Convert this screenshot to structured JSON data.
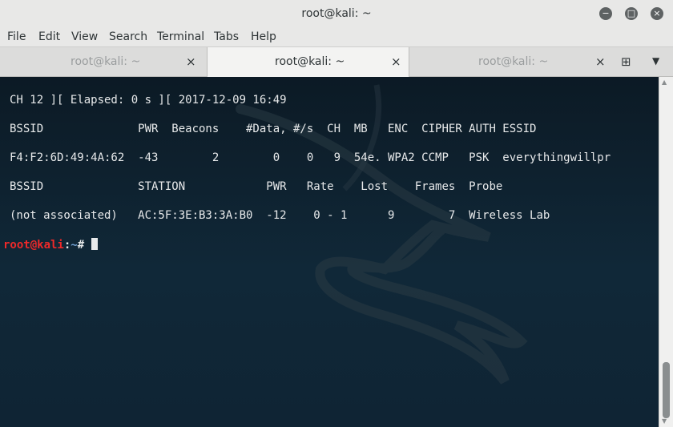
{
  "window": {
    "title": "root@kali: ~",
    "minimize_icon": "−",
    "maximize_icon": "□",
    "close_icon": "×"
  },
  "menu": [
    "File",
    "Edit",
    "View",
    "Search",
    "Terminal",
    "Tabs",
    "Help"
  ],
  "tabs": [
    {
      "label": "root@kali: ~",
      "close": "×",
      "active": false
    },
    {
      "label": "root@kali: ~",
      "close": "×",
      "active": true
    },
    {
      "label": "root@kali: ~",
      "close": "×",
      "active": false
    }
  ],
  "tabbar": {
    "new_tab_icon": "⊞",
    "menu_icon": "▼"
  },
  "terminal": {
    "lines": [
      "CH 12 ][ Elapsed: 0 s ][ 2017-12-09 16:49",
      "BSSID              PWR  Beacons    #Data, #/s  CH  MB   ENC  CIPHER AUTH ESSID",
      "F4:F2:6D:49:4A:62  -43        2        0    0   9  54e. WPA2 CCMP   PSK  everythingwillpr",
      "BSSID              STATION            PWR   Rate    Lost    Frames  Probe",
      "(not associated)   AC:5F:3E:B3:3A:B0  -12    0 - 1      9        7  Wireless Lab"
    ],
    "prompt_user": "root@kali",
    "prompt_sep": ":",
    "prompt_path": "~",
    "prompt_symbol": "# "
  },
  "scrollbar": {
    "up_icon": "▲",
    "down_icon": "▼"
  },
  "colors": {
    "prompt_user": "#ef2929",
    "prompt_path": "#729fcf",
    "terminal_bg": "#0f2434"
  }
}
